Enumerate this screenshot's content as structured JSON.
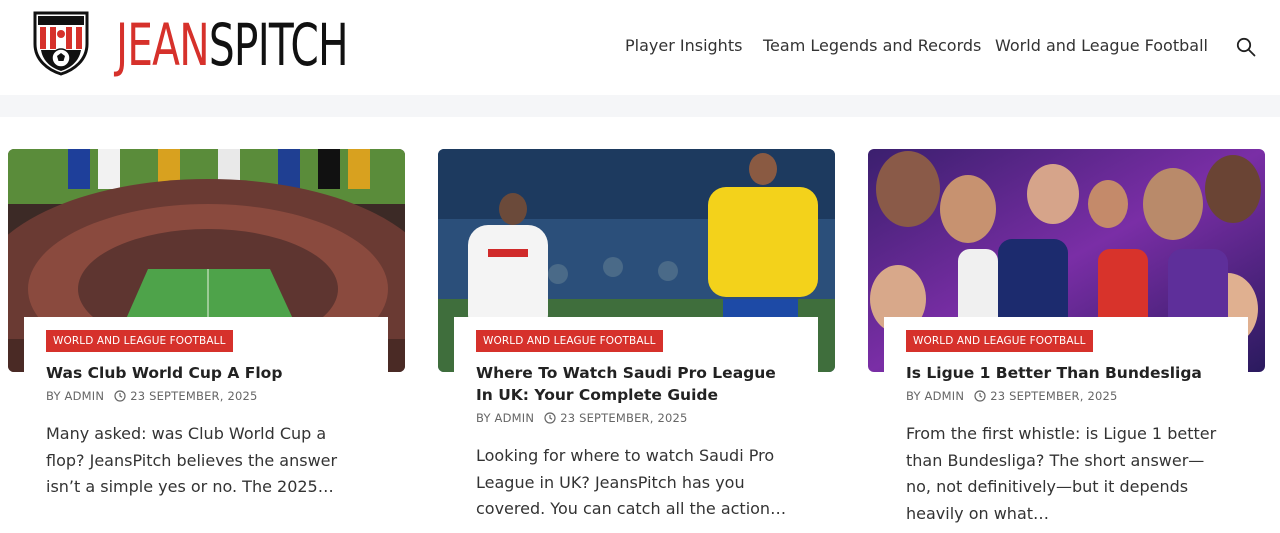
{
  "site": {
    "logo_red": "JEAN",
    "logo_black": "SPITCH",
    "colors": {
      "brand_red": "#d6312b",
      "text": "#2b2b2b"
    }
  },
  "nav": {
    "items": [
      {
        "label": "Player Insights"
      },
      {
        "label": "Team Legends and Records"
      },
      {
        "label": "World and League Football"
      }
    ],
    "search_icon": "search-icon"
  },
  "posts": [
    {
      "category": "WORLD AND LEAGUE FOOTBALL",
      "title": "Was Club World Cup A Flop",
      "author": "BY ADMIN",
      "date": "23 SEPTEMBER, 2025",
      "excerpt": "Many asked: was Club World Cup a flop? JeansPitch believes the answer isn’t a simple yes or no. The 2025…"
    },
    {
      "category": "WORLD AND LEAGUE FOOTBALL",
      "title": "Where To Watch Saudi Pro League In UK: Your Complete Guide",
      "author": "BY ADMIN",
      "date": "23 SEPTEMBER, 2025",
      "excerpt": "Looking for where to watch Saudi Pro League in UK? JeansPitch has you covered. You can catch all the action…"
    },
    {
      "category": "WORLD AND LEAGUE FOOTBALL",
      "title": "Is Ligue 1 Better Than Bundesliga",
      "author": "BY ADMIN",
      "date": "23 SEPTEMBER, 2025",
      "excerpt": "From the first whistle: is Ligue 1 better than Bundesliga? The short answer—no, not definitively—but it depends heavily on what…"
    }
  ]
}
